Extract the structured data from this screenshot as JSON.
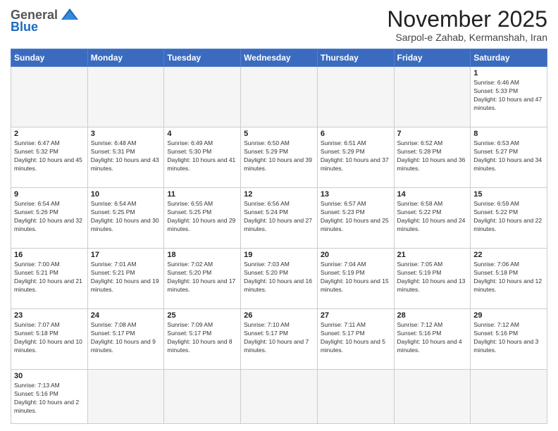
{
  "logo": {
    "general": "General",
    "blue": "Blue"
  },
  "header": {
    "month": "November 2025",
    "location": "Sarpol-e Zahab, Kermanshah, Iran"
  },
  "weekdays": [
    "Sunday",
    "Monday",
    "Tuesday",
    "Wednesday",
    "Thursday",
    "Friday",
    "Saturday"
  ],
  "weeks": [
    [
      {
        "day": null
      },
      {
        "day": null
      },
      {
        "day": null
      },
      {
        "day": null
      },
      {
        "day": null
      },
      {
        "day": null
      },
      {
        "day": "1",
        "sunrise": "6:46 AM",
        "sunset": "5:33 PM",
        "daylight": "10 hours and 47 minutes."
      }
    ],
    [
      {
        "day": "2",
        "sunrise": "6:47 AM",
        "sunset": "5:32 PM",
        "daylight": "10 hours and 45 minutes."
      },
      {
        "day": "3",
        "sunrise": "6:48 AM",
        "sunset": "5:31 PM",
        "daylight": "10 hours and 43 minutes."
      },
      {
        "day": "4",
        "sunrise": "6:49 AM",
        "sunset": "5:30 PM",
        "daylight": "10 hours and 41 minutes."
      },
      {
        "day": "5",
        "sunrise": "6:50 AM",
        "sunset": "5:29 PM",
        "daylight": "10 hours and 39 minutes."
      },
      {
        "day": "6",
        "sunrise": "6:51 AM",
        "sunset": "5:29 PM",
        "daylight": "10 hours and 37 minutes."
      },
      {
        "day": "7",
        "sunrise": "6:52 AM",
        "sunset": "5:28 PM",
        "daylight": "10 hours and 36 minutes."
      },
      {
        "day": "8",
        "sunrise": "6:53 AM",
        "sunset": "5:27 PM",
        "daylight": "10 hours and 34 minutes."
      }
    ],
    [
      {
        "day": "9",
        "sunrise": "6:54 AM",
        "sunset": "5:26 PM",
        "daylight": "10 hours and 32 minutes."
      },
      {
        "day": "10",
        "sunrise": "6:54 AM",
        "sunset": "5:25 PM",
        "daylight": "10 hours and 30 minutes."
      },
      {
        "day": "11",
        "sunrise": "6:55 AM",
        "sunset": "5:25 PM",
        "daylight": "10 hours and 29 minutes."
      },
      {
        "day": "12",
        "sunrise": "6:56 AM",
        "sunset": "5:24 PM",
        "daylight": "10 hours and 27 minutes."
      },
      {
        "day": "13",
        "sunrise": "6:57 AM",
        "sunset": "5:23 PM",
        "daylight": "10 hours and 25 minutes."
      },
      {
        "day": "14",
        "sunrise": "6:58 AM",
        "sunset": "5:22 PM",
        "daylight": "10 hours and 24 minutes."
      },
      {
        "day": "15",
        "sunrise": "6:59 AM",
        "sunset": "5:22 PM",
        "daylight": "10 hours and 22 minutes."
      }
    ],
    [
      {
        "day": "16",
        "sunrise": "7:00 AM",
        "sunset": "5:21 PM",
        "daylight": "10 hours and 21 minutes."
      },
      {
        "day": "17",
        "sunrise": "7:01 AM",
        "sunset": "5:21 PM",
        "daylight": "10 hours and 19 minutes."
      },
      {
        "day": "18",
        "sunrise": "7:02 AM",
        "sunset": "5:20 PM",
        "daylight": "10 hours and 17 minutes."
      },
      {
        "day": "19",
        "sunrise": "7:03 AM",
        "sunset": "5:20 PM",
        "daylight": "10 hours and 16 minutes."
      },
      {
        "day": "20",
        "sunrise": "7:04 AM",
        "sunset": "5:19 PM",
        "daylight": "10 hours and 15 minutes."
      },
      {
        "day": "21",
        "sunrise": "7:05 AM",
        "sunset": "5:19 PM",
        "daylight": "10 hours and 13 minutes."
      },
      {
        "day": "22",
        "sunrise": "7:06 AM",
        "sunset": "5:18 PM",
        "daylight": "10 hours and 12 minutes."
      }
    ],
    [
      {
        "day": "23",
        "sunrise": "7:07 AM",
        "sunset": "5:18 PM",
        "daylight": "10 hours and 10 minutes."
      },
      {
        "day": "24",
        "sunrise": "7:08 AM",
        "sunset": "5:17 PM",
        "daylight": "10 hours and 9 minutes."
      },
      {
        "day": "25",
        "sunrise": "7:09 AM",
        "sunset": "5:17 PM",
        "daylight": "10 hours and 8 minutes."
      },
      {
        "day": "26",
        "sunrise": "7:10 AM",
        "sunset": "5:17 PM",
        "daylight": "10 hours and 7 minutes."
      },
      {
        "day": "27",
        "sunrise": "7:11 AM",
        "sunset": "5:17 PM",
        "daylight": "10 hours and 5 minutes."
      },
      {
        "day": "28",
        "sunrise": "7:12 AM",
        "sunset": "5:16 PM",
        "daylight": "10 hours and 4 minutes."
      },
      {
        "day": "29",
        "sunrise": "7:12 AM",
        "sunset": "5:16 PM",
        "daylight": "10 hours and 3 minutes."
      }
    ],
    [
      {
        "day": "30",
        "sunrise": "7:13 AM",
        "sunset": "5:16 PM",
        "daylight": "10 hours and 2 minutes."
      },
      {
        "day": null
      },
      {
        "day": null
      },
      {
        "day": null
      },
      {
        "day": null
      },
      {
        "day": null
      },
      {
        "day": null
      }
    ]
  ]
}
